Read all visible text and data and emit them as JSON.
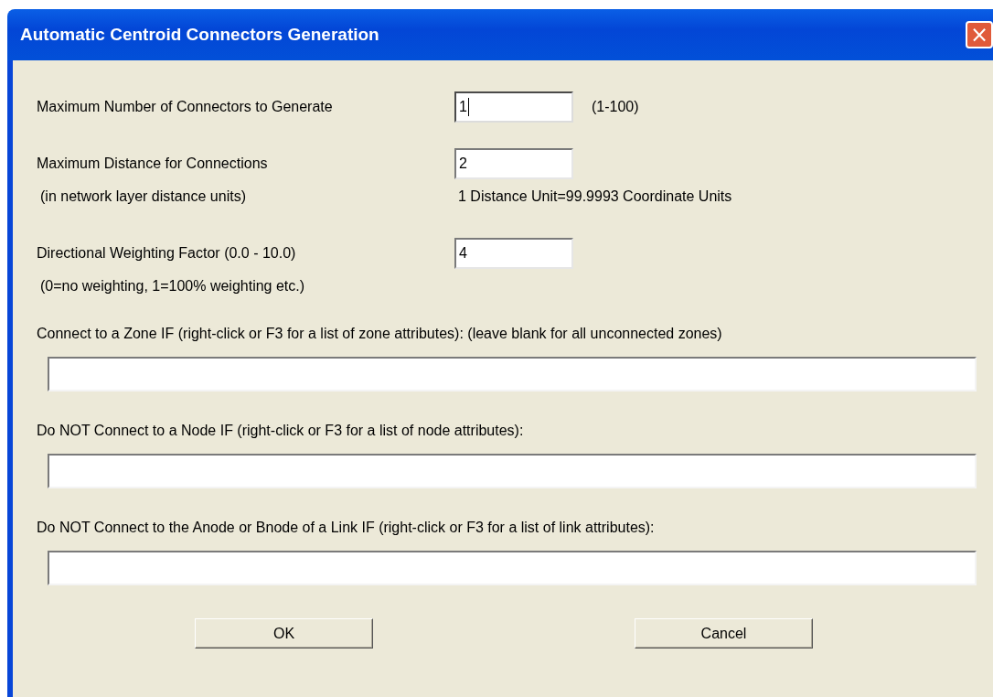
{
  "window": {
    "title": "Automatic Centroid Connectors Generation",
    "close": "×"
  },
  "rows": [
    {
      "label": "Maximum Number of Connectors to Generate",
      "value": "1",
      "focused": true,
      "hint": "(1-100)"
    },
    {
      "label": "Maximum Distance for Connections",
      "value": "2",
      "focused": false,
      "note": "(in network layer distance units)",
      "hint_below": "1 Distance Unit=99.9993 Coordinate Units"
    },
    {
      "label": "Directional Weighting Factor (0.0 - 10.0)",
      "value": "4",
      "focused": false,
      "note": "(0=no weighting, 1=100% weighting etc.)"
    }
  ],
  "conditions": [
    {
      "label": "Connect to a Zone IF (right-click or F3 for a list of zone attributes): (leave blank for all unconnected zones)"
    },
    {
      "label": "Do NOT Connect to a Node IF (right-click or F3 for a list of node attributes):"
    },
    {
      "label": "Do NOT Connect to the Anode or Bnode of a Link IF (right-click or F3 for a list of link attributes):"
    }
  ],
  "buttons": [
    "OK",
    "Cancel"
  ]
}
